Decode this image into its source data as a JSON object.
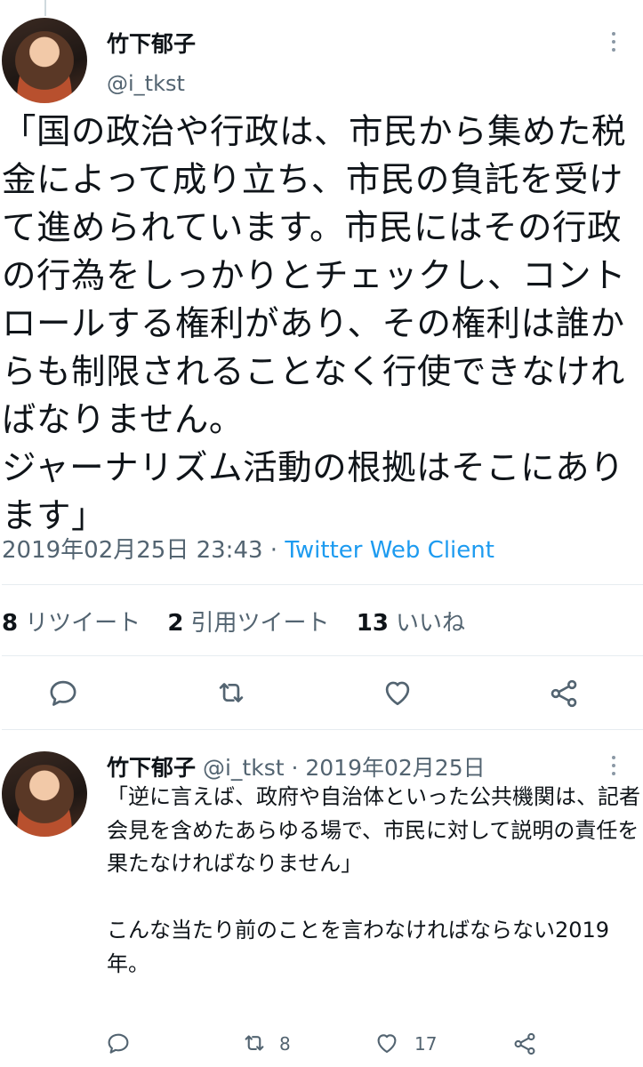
{
  "main_tweet": {
    "display_name": "竹下郁子",
    "handle": "@i_tkst",
    "text": "「国の政治や行政は、市民から集めた税金によって成り立ち、市民の負託を受けて進められています。市民にはその行政の行為をしっかりとチェックし、コントロールする権利があり、その権利は誰からも制限されることなく行使できなければなりません。\nジャーナリズム活動の根拠はそこにあります」",
    "timestamp": "2019年02月25日 23:43",
    "separator": " · ",
    "client": "Twitter Web Client",
    "stats": {
      "retweets_count": "8",
      "retweets_label": "リツイート",
      "quotes_count": "2",
      "quotes_label": "引用ツイート",
      "likes_count": "13",
      "likes_label": "いいね"
    }
  },
  "reply_tweet": {
    "display_name": "竹下郁子",
    "handle": "@i_tkst",
    "separator": " · ",
    "date": "2019年02月25日",
    "text": "「逆に言えば、政府や自治体といった公共機関は、記者会見を含めたあらゆる場で、市民に対して説明の責任を果たなければなりません」\n\nこんな当たり前のことを言わなければならない2019年。",
    "retweet_count": "8",
    "like_count": "17"
  },
  "icons": [
    "reply-icon",
    "retweet-icon",
    "like-icon",
    "share-icon",
    "more-icon"
  ],
  "colors": {
    "link": "#1d9bf0",
    "secondary": "#536471",
    "text": "#0f1419"
  }
}
